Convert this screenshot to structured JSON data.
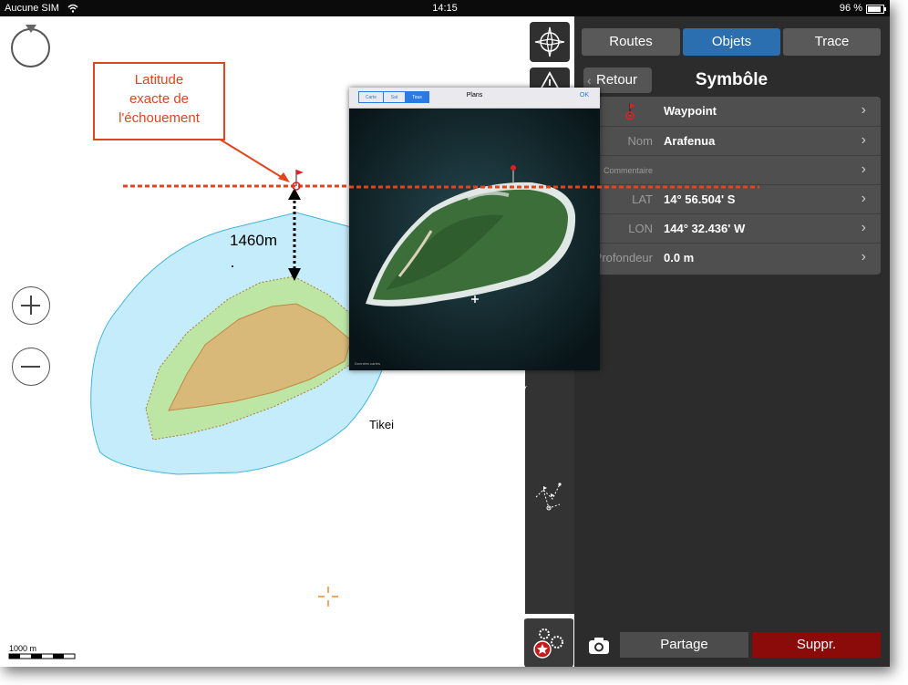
{
  "status_bar": {
    "carrier": "Aucune SIM",
    "time": "14:15",
    "battery": "96 %"
  },
  "map": {
    "annotation": {
      "line1": "Latitude",
      "line2": "exacte de",
      "line3": "l'échouement"
    },
    "distance_label": "1460m",
    "place_label": "Tikei",
    "scale_label": "1000 m"
  },
  "satellite": {
    "tabs": [
      {
        "label": "Carte"
      },
      {
        "label": "Sat"
      },
      {
        "label": "Tous"
      }
    ],
    "active_tab": "Tous",
    "title": "Plans",
    "ok_label": "OK",
    "credit": "Données cartes"
  },
  "panel": {
    "tabs": [
      {
        "label": "Routes"
      },
      {
        "label": "Objets"
      },
      {
        "label": "Trace"
      }
    ],
    "active_tab": "Objets",
    "back_label": "Retour",
    "title": "Symbôle",
    "rows": [
      {
        "label": "",
        "value": "Waypoint"
      },
      {
        "label": "Nom",
        "value": "Arafenua"
      },
      {
        "label": "Commentaire",
        "value": ""
      },
      {
        "label": "LAT",
        "value": "14° 56.504' S"
      },
      {
        "label": "LON",
        "value": "144° 32.436' W"
      },
      {
        "label": "Profondeur",
        "value": "0.0 m"
      }
    ],
    "share_label": "Partage",
    "delete_label": "Suppr."
  },
  "colors": {
    "accent": "#2b6fb0",
    "annotation": "#e0451f",
    "delete": "#8b0a0a",
    "water": "#c5ecfa",
    "reef": "#bde6a5",
    "land": "#d8b97a"
  }
}
